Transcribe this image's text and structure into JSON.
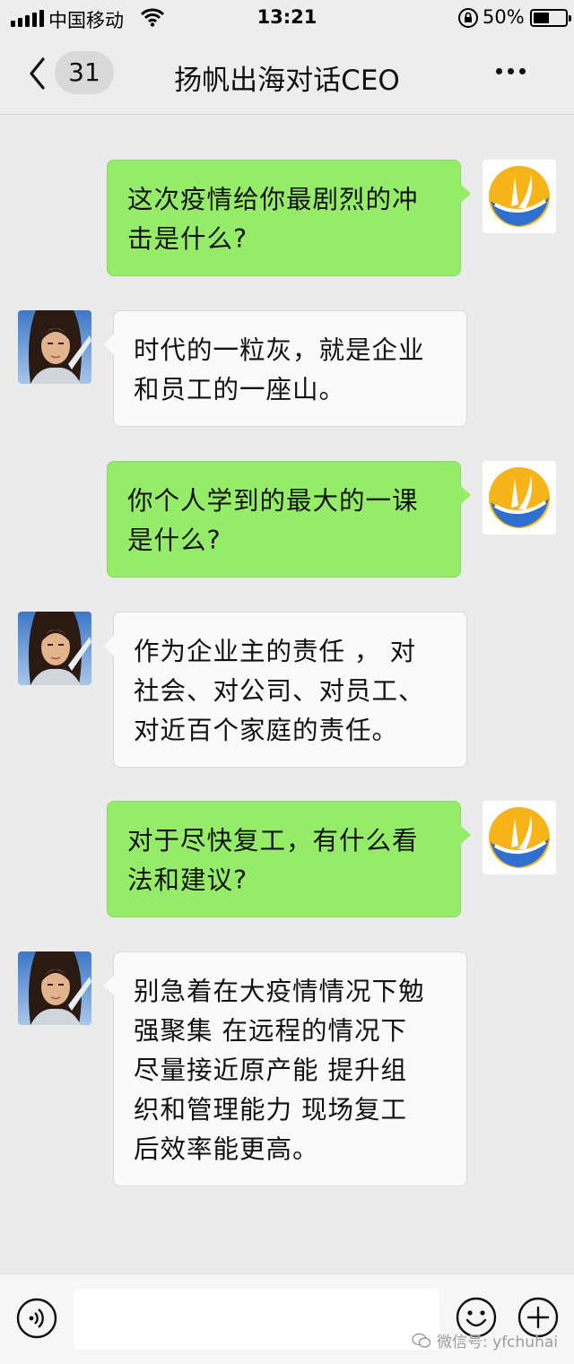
{
  "status_bar": {
    "carrier": "中国移动",
    "time": "13:21",
    "battery_percent": "50%",
    "battery_level": 0.5
  },
  "nav": {
    "unread_count": "31",
    "title": "扬帆出海对话CEO",
    "icons": {
      "back": "chevron-left-icon",
      "more": "more-dots-icon"
    }
  },
  "messages": [
    {
      "sender": "self",
      "lines": [
        "这次疫情给你最剧烈的冲",
        "击是什么?"
      ]
    },
    {
      "sender": "other",
      "lines": [
        "时代的一粒灰，就是企业",
        "和员工的一座山。"
      ]
    },
    {
      "sender": "self",
      "lines": [
        "你个人学到的最大的一课",
        "是什么?"
      ]
    },
    {
      "sender": "other",
      "lines": [
        "作为企业主的责任 ， 对",
        "社会、对公司、对员工、",
        "对近百个家庭的责任。"
      ]
    },
    {
      "sender": "self",
      "lines": [
        "对于尽快复工，有什么看",
        "法和建议?"
      ]
    },
    {
      "sender": "other",
      "lines": [
        "别急着在大疫情情况下勉",
        "强聚集 在远程的情况下",
        "尽量接近原产能 提升组",
        "织和管理能力 现场复工",
        "后效率能更高。"
      ]
    }
  ],
  "input_bar": {
    "placeholder": "",
    "icons": [
      "voice-icon",
      "emoji-icon",
      "plus-icon"
    ]
  },
  "watermark": "微信号: yfchuhai",
  "colors": {
    "self_bubble": "#95ec69",
    "other_bubble": "#fafafa",
    "background": "#ebebeb"
  }
}
